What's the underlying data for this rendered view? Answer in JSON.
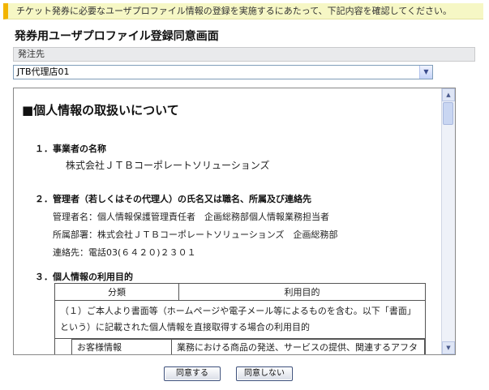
{
  "notice": "チケット発券に必要なユーザプロファイル情報の登録を実施するにあたって、下記内容を確認してください。",
  "page_title": "発券用ユーザプロファイル登録同意画面",
  "order_section": {
    "label": "発注先",
    "selected": "JTB代理店01"
  },
  "document": {
    "heading": "■個人情報の取扱いについて",
    "section1": {
      "title": "１．事業者の名称",
      "body": "株式会社ＪＴＢコーポレートソリューションズ"
    },
    "section2": {
      "title": "２．管理者（若しくはその代理人）の氏名又は職名、所属及び連絡先",
      "lines": [
        "管理者名：個人情報保護管理責任者　企画総務部個人情報業務担当者",
        "所属部署：株式会社ＪＴＢコーポレートソリューションズ　企画総務部",
        "連絡先：電話03(６４２０)２３０１"
      ]
    },
    "section3": {
      "title": "３．個人情報の利用目的",
      "table": {
        "headers": [
          "分類",
          "利用目的"
        ],
        "row1": "（１）ご本人より書面等（ホームページや電子メール等によるものを含む。以下「書面」という）に記載された個人情報を直接取得する場合の利用目的",
        "row2_category": "お客様情報",
        "row2_purpose": "業務における商品の発送、サービスの提供、関連するアフターサービ"
      }
    }
  },
  "buttons": {
    "agree": "同意する",
    "disagree": "同意しない"
  },
  "colors": {
    "notice_bg": "#f6f7c5",
    "notice_accent": "#f2b400",
    "button_border": "#3c4f7a"
  }
}
